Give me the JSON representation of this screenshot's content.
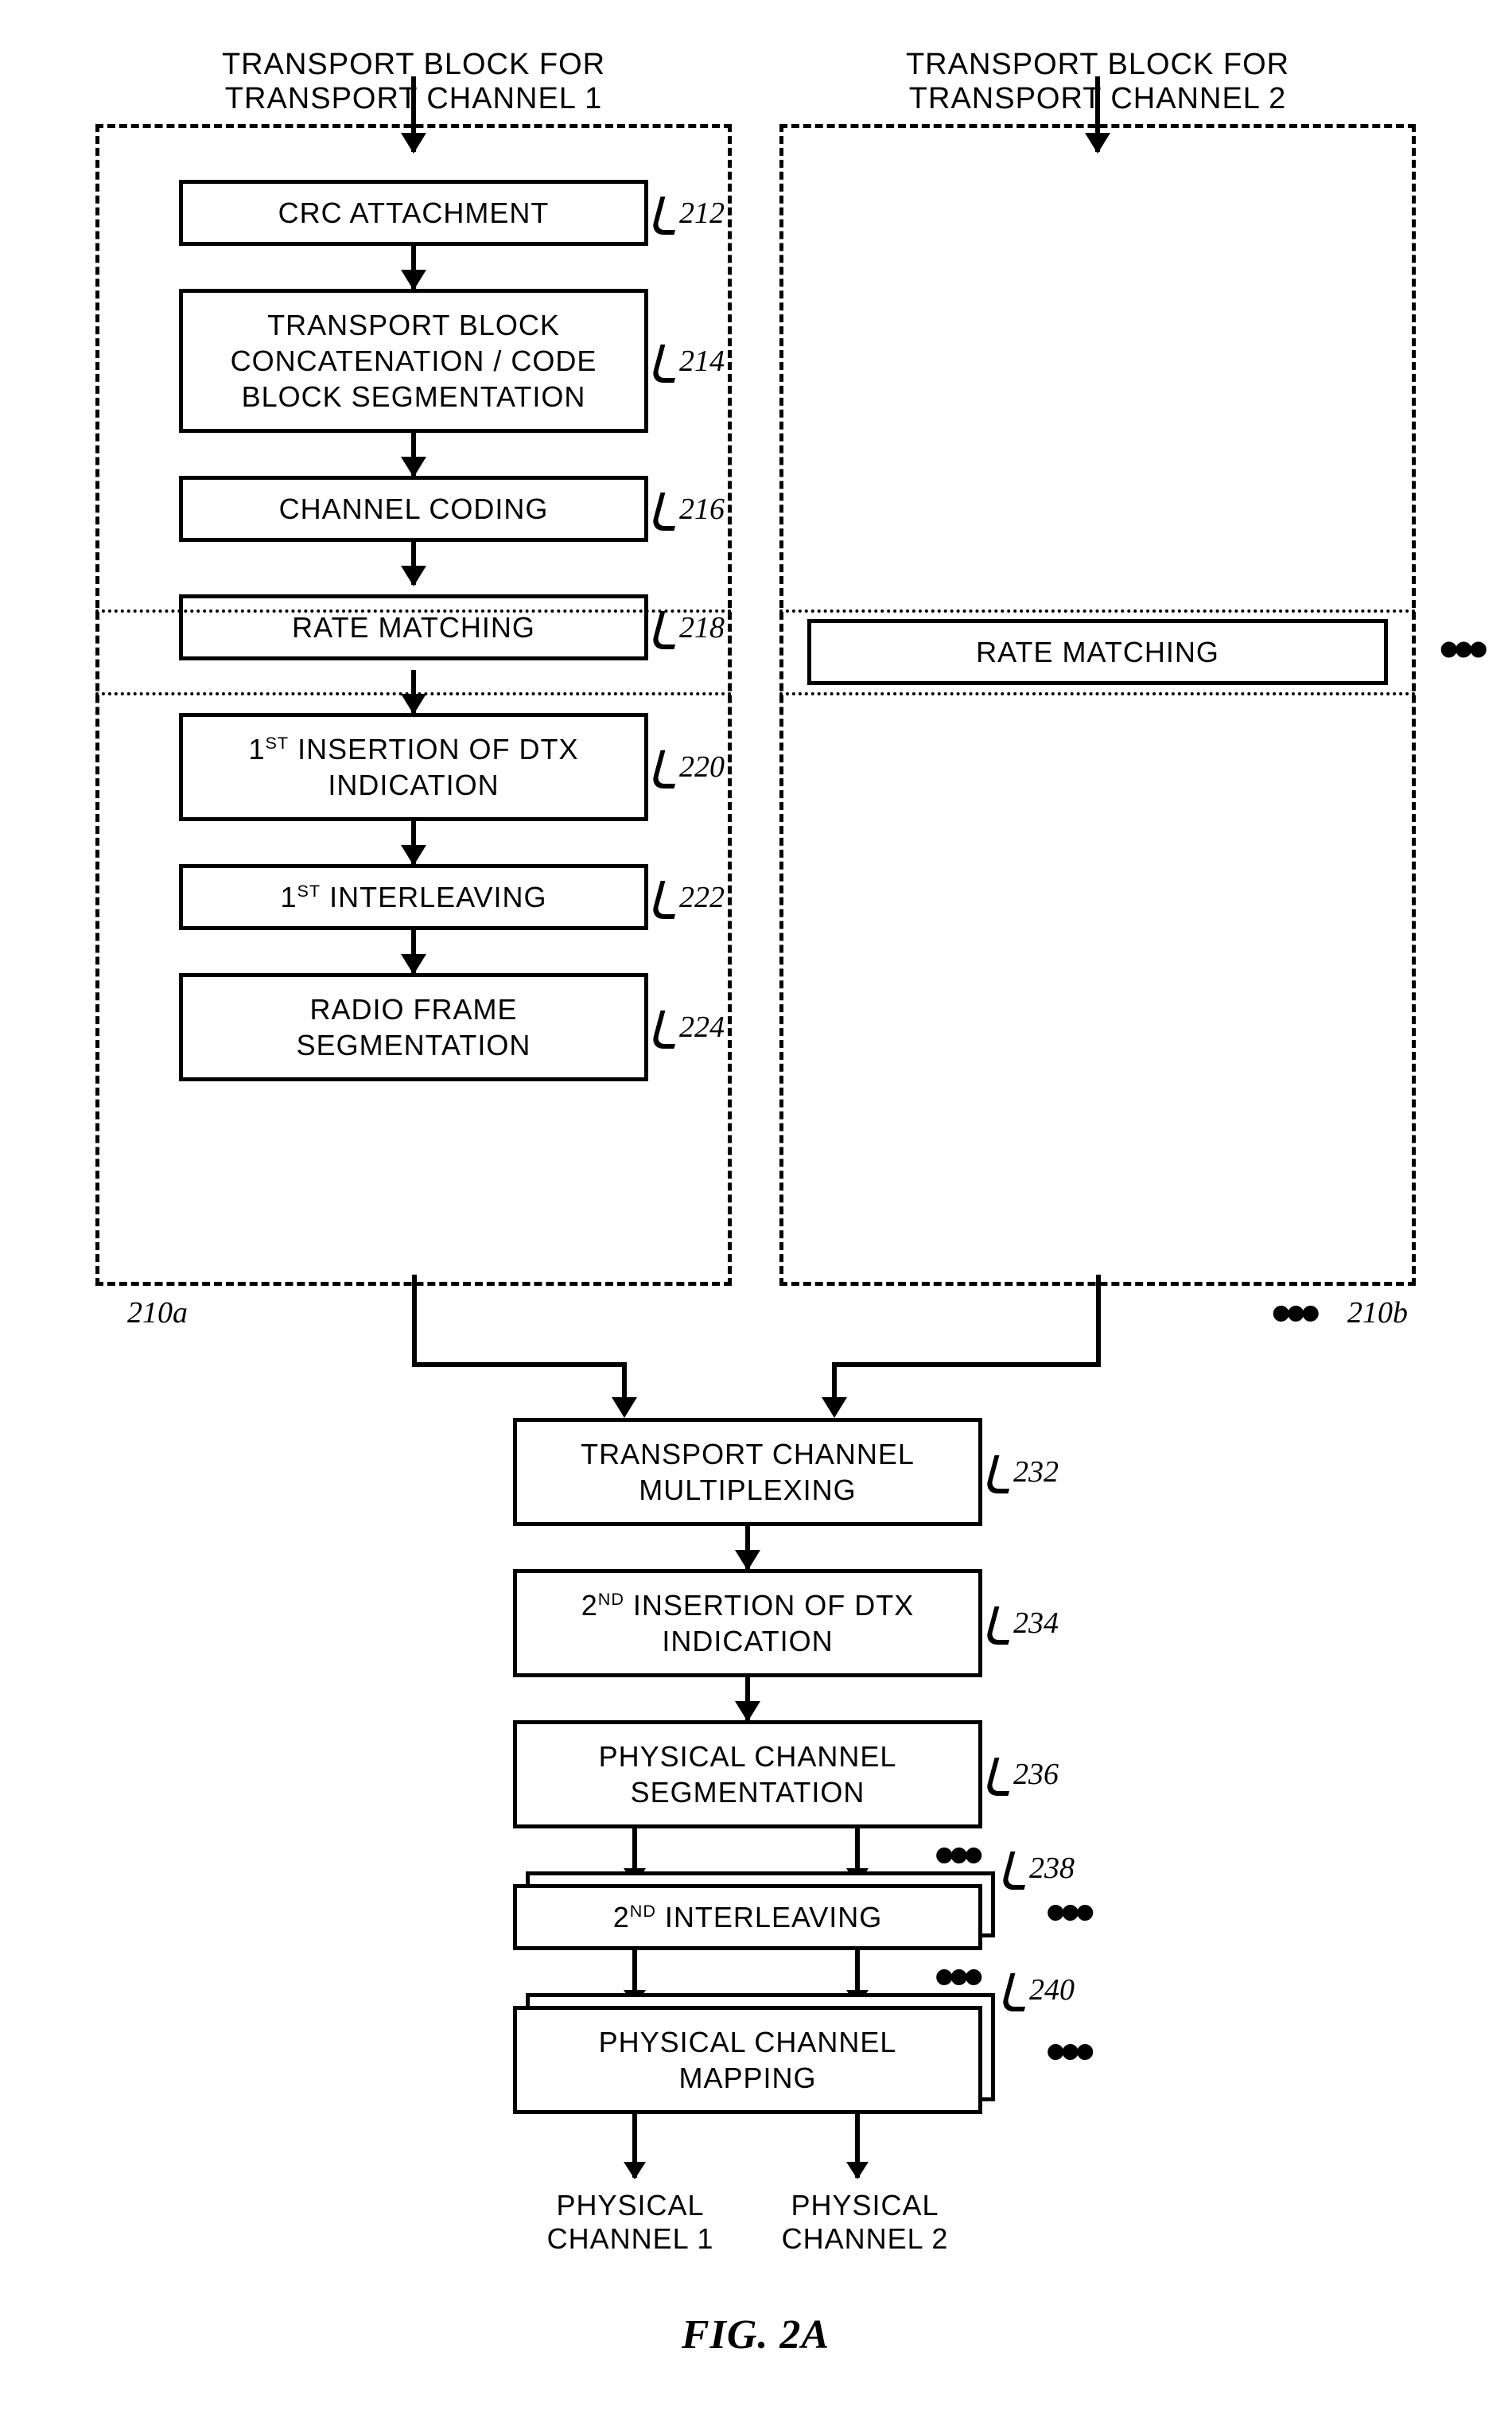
{
  "headers": {
    "ch1": "TRANSPORT BLOCK FOR\nTRANSPORT CHANNEL 1",
    "ch2": "TRANSPORT BLOCK FOR\nTRANSPORT CHANNEL 2"
  },
  "ch1_blocks": {
    "b212": "CRC ATTACHMENT",
    "b214": "TRANSPORT BLOCK\nCONCATENATION / CODE\nBLOCK SEGMENTATION",
    "b216": "CHANNEL CODING",
    "b218": "RATE MATCHING",
    "b220_pre": "1",
    "b220_sup": "ST",
    "b220_post": " INSERTION OF DTX\nINDICATION",
    "b222_pre": "1",
    "b222_sup": "ST",
    "b222_post": " INTERLEAVING",
    "b224": "RADIO FRAME\nSEGMENTATION"
  },
  "ch2_blocks": {
    "rate": "RATE MATCHING"
  },
  "refs": {
    "r212": "212",
    "r214": "214",
    "r216": "216",
    "r218": "218",
    "r220": "220",
    "r222": "222",
    "r224": "224",
    "r210a": "210a",
    "r210b": "210b",
    "r232": "232",
    "r234": "234",
    "r236": "236",
    "r238": "238",
    "r240": "240"
  },
  "bottom_blocks": {
    "b232": "TRANSPORT CHANNEL\nMULTIPLEXING",
    "b234_pre": "2",
    "b234_sup": "ND",
    "b234_post": " INSERTION OF DTX\nINDICATION",
    "b236": "PHYSICAL CHANNEL\nSEGMENTATION",
    "b238_pre": "2",
    "b238_sup": "ND",
    "b238_post": " INTERLEAVING",
    "b240": "PHYSICAL CHANNEL\nMAPPING"
  },
  "outputs": {
    "o1": "PHYSICAL\nCHANNEL 1",
    "o2": "PHYSICAL\nCHANNEL 2"
  },
  "figure": "FIG. 2A",
  "ellipsis": "•••"
}
